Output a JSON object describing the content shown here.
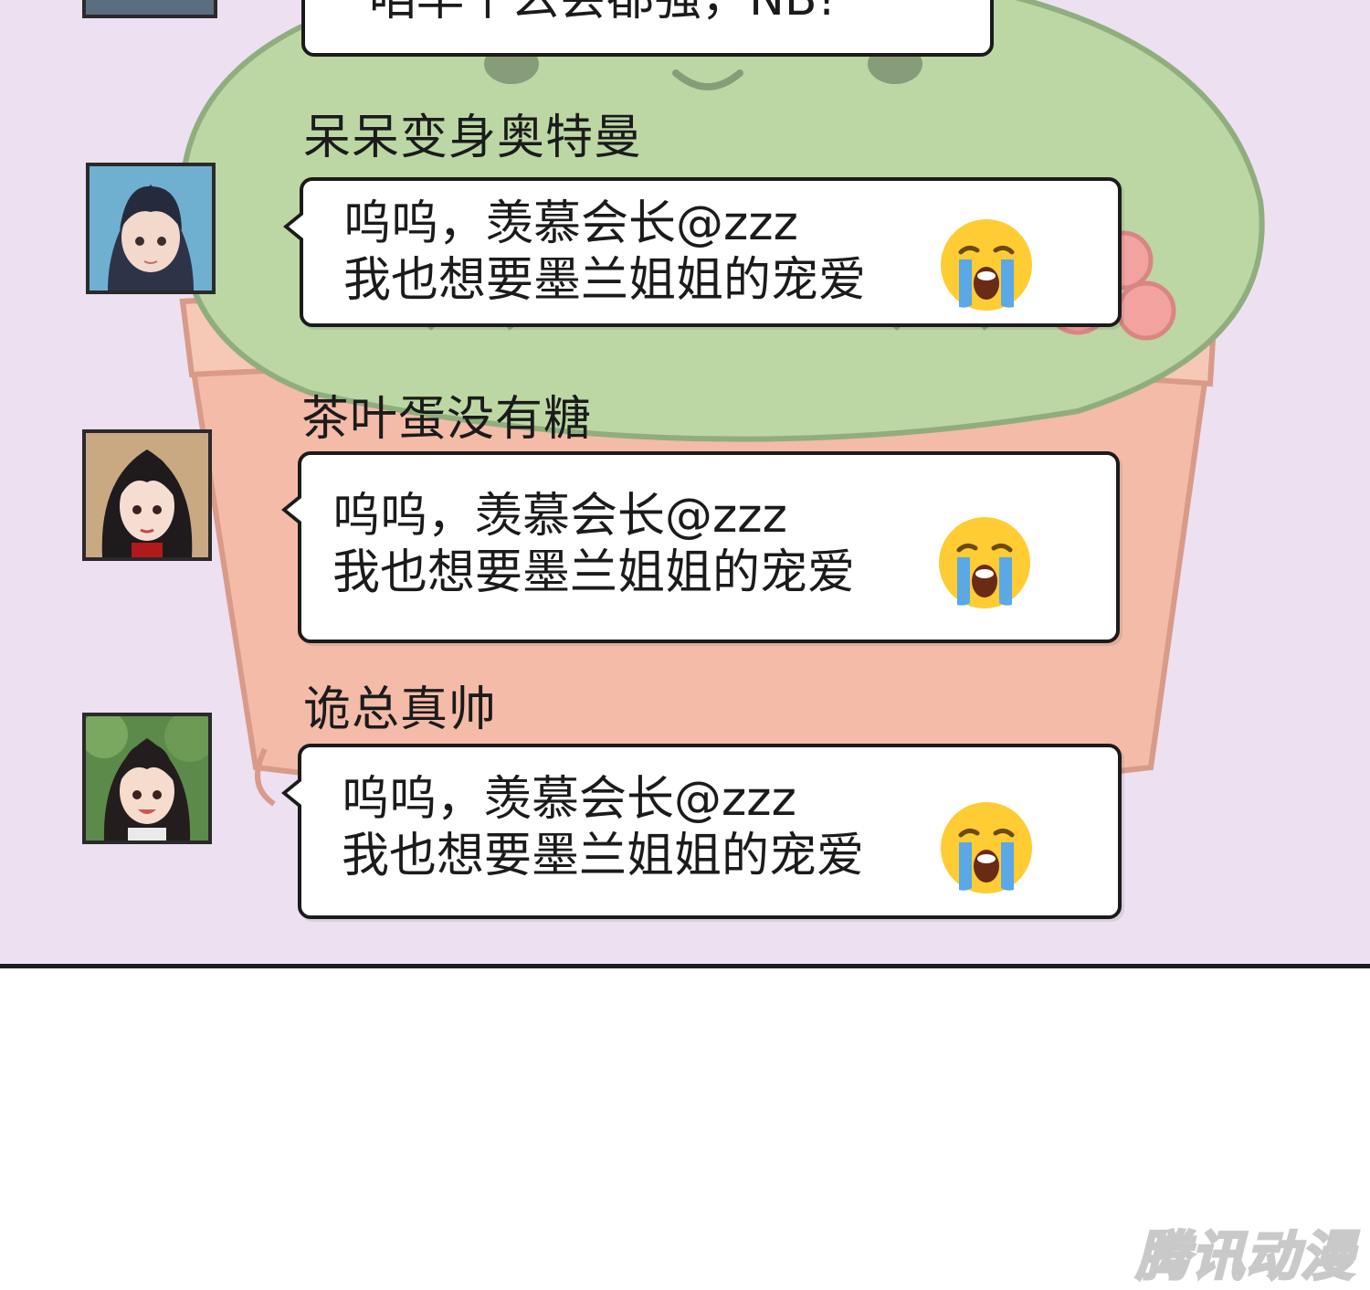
{
  "top_partial": {
    "text": "咱早个么会都强，NB!"
  },
  "messages": [
    {
      "sender": "呆呆变身奥特曼",
      "lines": [
        "呜呜，羡慕会长@zzz",
        "我也想要墨兰姐姐的宠爱"
      ],
      "emoji": "loudly-crying-face"
    },
    {
      "sender": "茶叶蛋没有糖",
      "lines": [
        "呜呜，羡慕会长@zzz",
        "我也想要墨兰姐姐的宠爱"
      ],
      "emoji": "loudly-crying-face"
    },
    {
      "sender": "诡总真帅",
      "lines": [
        "呜呜，羡慕会长@zzz",
        "我也想要墨兰姐姐的宠爱"
      ],
      "emoji": "loudly-crying-face"
    }
  ],
  "watermark": "腾讯动漫",
  "colors": {
    "panel_bg": "#ece0f1",
    "cactus": "#b9d6a0",
    "pot": "#f2b7a4",
    "emoji_face": "#ffcc33",
    "emoji_tears": "#5aa8e6"
  }
}
